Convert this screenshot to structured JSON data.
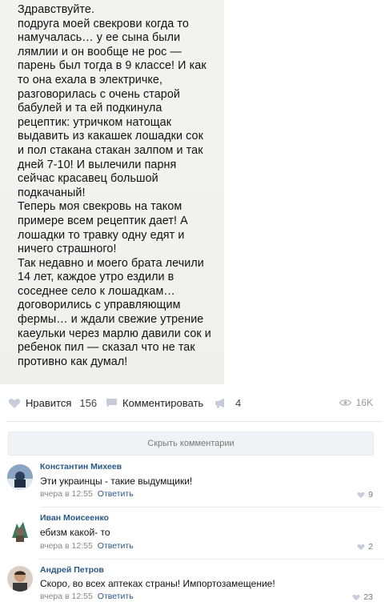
{
  "post": {
    "text": "Здравствуйте.\nподруга моей свекрови когда то\nнамучалась… у ее сына были\nлямлии и он вообще не рос —\nпарень был тогда в 9 классе! И как\nто она ехала в электричке,\nразговорилась с очень старой\nбабулей и та ей подкинула\nрецептик: утричком натощак\nвыдавить из какашек лошадки сок\nи пол стакана стакан залпом и так\nдней 7-10! И вылечили парня\nсейчас красавец большой\nподкачаный!\nТеперь моя свекровь на таком\nпримере всем рецептик дает! А\nлошадки то травку одну едят и\nничего страшного!\nТак недавно и моего брата лечили\n14 лет, каждое утро ездили в\nсоседнее село к лошадкам…\nдоговорились с управляющим\nфермы… и ждали свежие утрение\nкаеульки через марлю давили сок и\nребенок пил — сказал что не так\nпротивно как думал!"
  },
  "actions": {
    "like_label": "Нравится",
    "like_count": "156",
    "comment_label": "Комментировать",
    "share_count": "4",
    "views": "16K"
  },
  "hide_comments_label": "Скрыть комментарии",
  "comments": [
    {
      "name": "Константин Михеев",
      "text": "Эти украинцы - такие выдумщики!",
      "time": "вчера в 12:55",
      "reply": "Ответить",
      "likes": "9"
    },
    {
      "name": "Иван Моисеенко",
      "text": "ебизм какой- то",
      "time": "вчера в 12:55",
      "reply": "Ответить",
      "likes": "2"
    },
    {
      "name": "Андрей Петров",
      "text": "Скоро, во всех аптеках страны! Импортозамещение!",
      "time": "вчера в 12:55",
      "reply": "Ответить",
      "likes": "23"
    }
  ],
  "colors": {
    "link_blue": "#2a5885",
    "muted": "#888888",
    "panel": "#f0f2f5"
  }
}
